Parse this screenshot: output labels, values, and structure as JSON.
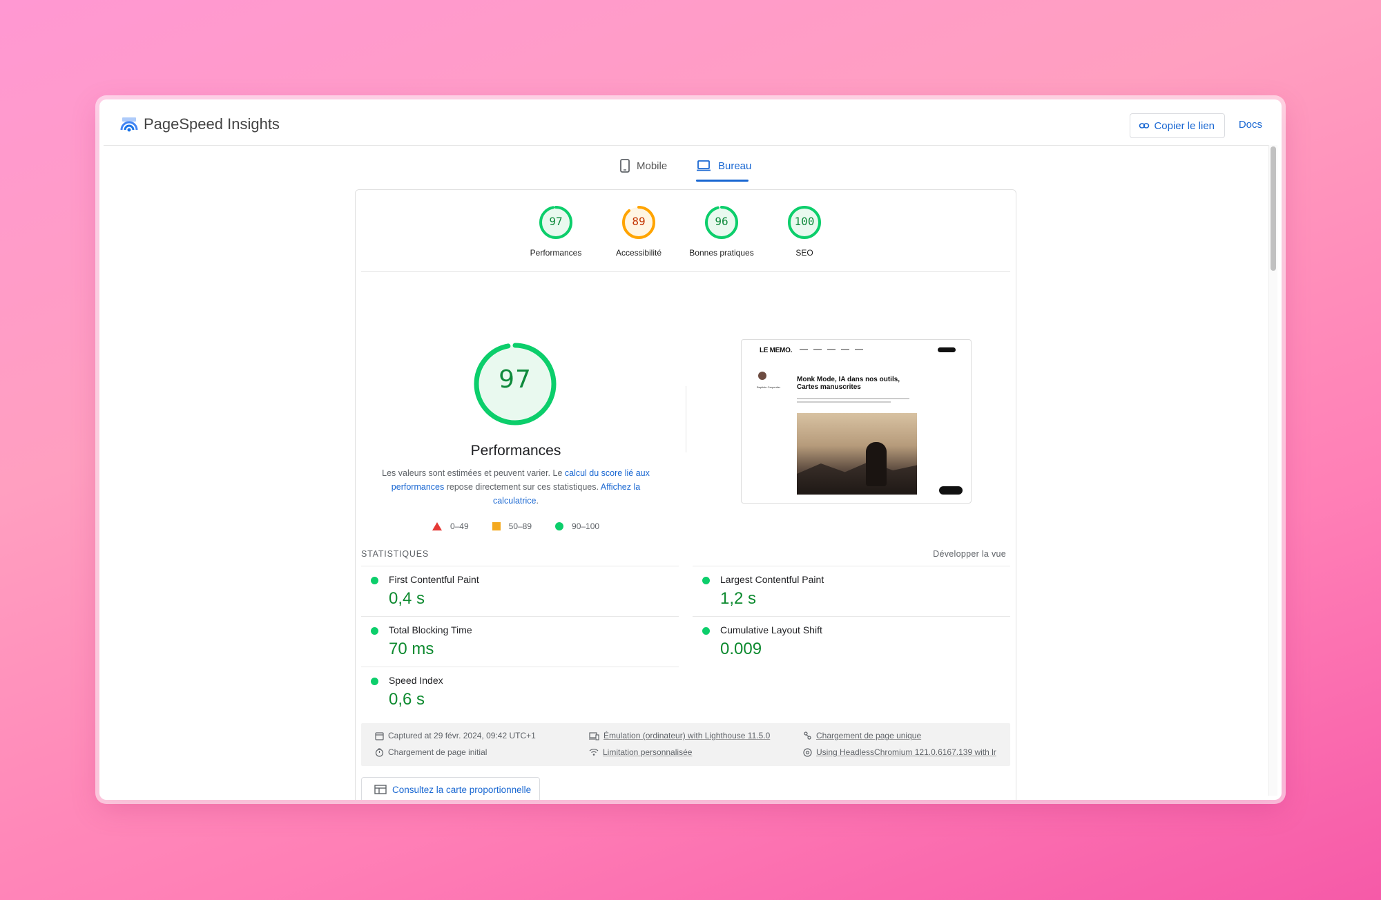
{
  "app": {
    "title": "PageSpeed Insights"
  },
  "header": {
    "copy_link": "Copier le lien",
    "docs": "Docs"
  },
  "tabs": [
    {
      "label": "Mobile",
      "active": false
    },
    {
      "label": "Bureau",
      "active": true
    }
  ],
  "categories": [
    {
      "score": 97,
      "label": "Performances",
      "status": "pass"
    },
    {
      "score": 89,
      "label": "Accessibilité",
      "status": "average"
    },
    {
      "score": 96,
      "label": "Bonnes pratiques",
      "status": "pass"
    },
    {
      "score": 100,
      "label": "SEO",
      "status": "pass"
    }
  ],
  "performance": {
    "score": 97,
    "title": "Performances",
    "desc_1": "Les valeurs sont estimées et peuvent varier. Le ",
    "desc_link_1": "calcul du score lié aux performances",
    "desc_2": " repose directement sur ces statistiques. ",
    "desc_link_2": "Affichez la calculatrice",
    "desc_3": "."
  },
  "legend": [
    {
      "range": "0–49",
      "shape": "triangle",
      "color": "#e53935"
    },
    {
      "range": "50–89",
      "shape": "square",
      "color": "#f4a91f"
    },
    {
      "range": "90–100",
      "shape": "circle",
      "color": "#0cce6b"
    }
  ],
  "preview": {
    "logo": "LE MEMO.",
    "headline": "Monk Mode, IA dans nos outils, Cartes manuscrites",
    "author": "Baptiste Carpentier"
  },
  "stats": {
    "label": "STATISTIQUES",
    "expand": "Développer la vue",
    "metrics": [
      {
        "name": "First Contentful Paint",
        "value": "0,4 s"
      },
      {
        "name": "Largest Contentful Paint",
        "value": "1,2 s"
      },
      {
        "name": "Total Blocking Time",
        "value": "70 ms"
      },
      {
        "name": "Cumulative Layout Shift",
        "value": "0.009"
      },
      {
        "name": "Speed Index",
        "value": "0,6 s"
      }
    ]
  },
  "info": {
    "captured": "Captured at 29 févr. 2024, 09:42 UTC+1",
    "emulation": "Émulation (ordinateur) with Lighthouse 11.5.0",
    "load_type": "Chargement de page unique",
    "initial_load": "Chargement de page initial",
    "throttling": "Limitation personnalisée",
    "browser": "Using HeadlessChromium 121.0.6167.139 with lr"
  },
  "treemap_button": "Consultez la carte proportionnelle",
  "colors": {
    "pass": "#0cce6b",
    "average": "#ffa400",
    "fail": "#ff4e42",
    "link": "#1967d2"
  }
}
